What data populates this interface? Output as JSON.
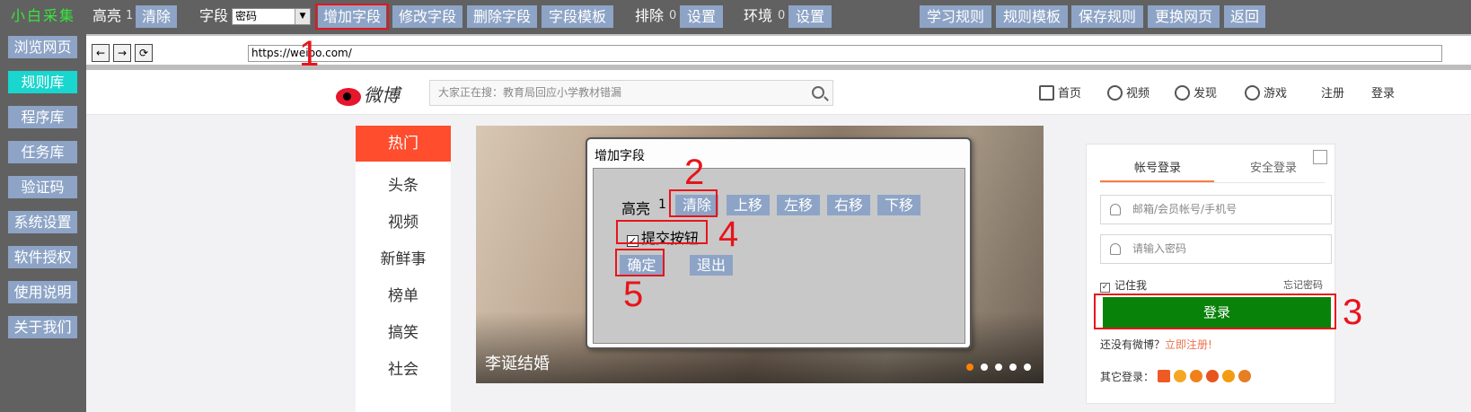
{
  "toolbar": {
    "brand": "小白采集",
    "highlight_label": "高亮",
    "highlight_count": "1",
    "clear_label": "清除",
    "field_label": "字段",
    "field_select_value": "密码",
    "add_field": "增加字段",
    "edit_field": "修改字段",
    "delete_field": "删除字段",
    "field_template": "字段模板",
    "exclude_label": "排除",
    "exclude_count": "0",
    "exclude_settings": "设置",
    "env_label": "环境",
    "env_count": "0",
    "env_settings": "设置",
    "learn_rules": "学习规则",
    "rule_template": "规则模板",
    "save_rules": "保存规则",
    "change_page": "更换网页",
    "back": "返回"
  },
  "sidebar": {
    "items": [
      {
        "label": "浏览网页"
      },
      {
        "label": "规则库"
      },
      {
        "label": "程序库"
      },
      {
        "label": "任务库"
      },
      {
        "label": "验证码"
      },
      {
        "label": "系统设置"
      },
      {
        "label": "软件授权"
      },
      {
        "label": "使用说明"
      },
      {
        "label": "关于我们"
      }
    ],
    "active_index": 1
  },
  "browser": {
    "back_glyph": "←",
    "forward_glyph": "→",
    "refresh_glyph": "⟳",
    "url": "https://weibo.com/"
  },
  "annotations": {
    "n1": "1",
    "n2": "2",
    "n3": "3",
    "n4": "4",
    "n5": "5",
    "color": "#e8141b"
  },
  "weibo": {
    "logo_text": "微博",
    "search_placeholder": "大家正在搜：教育局回应小学教材错漏",
    "nav": {
      "home": "首页",
      "video": "视频",
      "discover": "发现",
      "game": "游戏",
      "register": "注册",
      "login": "登录"
    },
    "channels": [
      "热门",
      "头条",
      "视频",
      "新鲜事",
      "榜单",
      "搞笑",
      "社会"
    ],
    "banner_caption": "李诞结婚",
    "login_panel": {
      "tab_account": "帐号登录",
      "tab_secure": "安全登录",
      "username_placeholder": "邮箱/会员帐号/手机号",
      "password_placeholder": "请输入密码",
      "remember_me": "记住我",
      "forgot_password": "忘记密码",
      "login_button": "登录",
      "no_account": "还没有微博？",
      "register_now": "立即注册!",
      "other_login": "其它登录："
    }
  },
  "dialog": {
    "title": "增加字段",
    "highlight_label": "高亮",
    "highlight_count": "1",
    "clear": "清除",
    "move_up": "上移",
    "move_left": "左移",
    "move_right": "右移",
    "move_down": "下移",
    "submit_checkbox_label": "提交按钮",
    "submit_checked": true,
    "confirm": "确定",
    "exit": "退出"
  }
}
